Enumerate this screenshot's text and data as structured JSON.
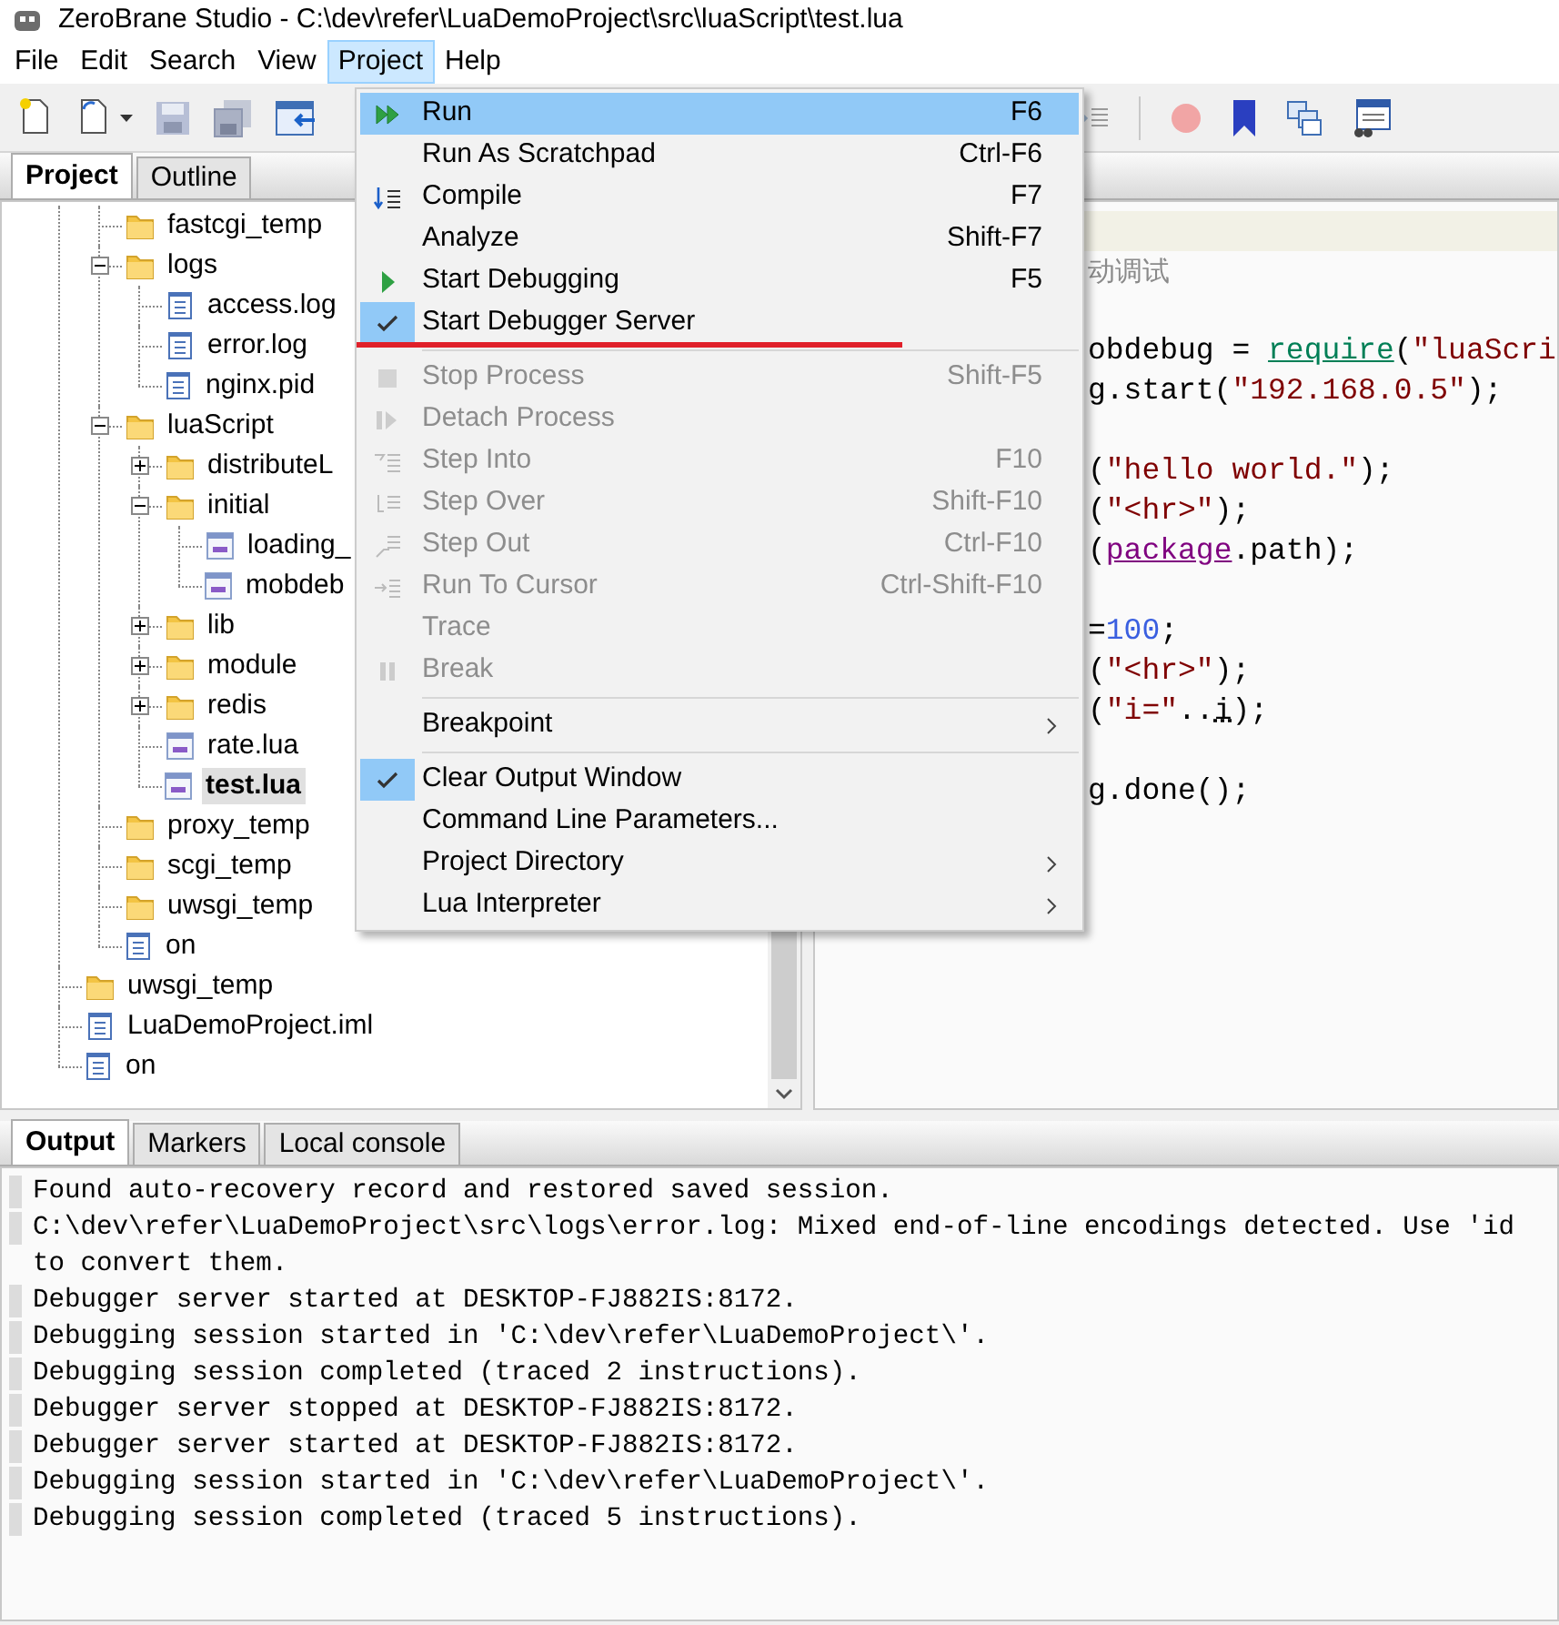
{
  "window": {
    "title": "ZeroBrane Studio - C:\\dev\\refer\\LuaDemoProject\\src\\luaScript\\test.lua"
  },
  "menubar": [
    {
      "label": "File",
      "selected": false
    },
    {
      "label": "Edit",
      "selected": false
    },
    {
      "label": "Search",
      "selected": false
    },
    {
      "label": "View",
      "selected": false
    },
    {
      "label": "Project",
      "selected": true
    },
    {
      "label": "Help",
      "selected": false
    }
  ],
  "project_menu": [
    {
      "kind": "item",
      "label": "Run",
      "shortcut": "F6",
      "selected": true,
      "checked": false,
      "disabled": false,
      "submenu": false,
      "annotated": false
    },
    {
      "kind": "item",
      "label": "Run As Scratchpad",
      "shortcut": "Ctrl-F6",
      "selected": false,
      "checked": false,
      "disabled": false,
      "submenu": false,
      "annotated": false
    },
    {
      "kind": "item",
      "label": "Compile",
      "shortcut": "F7",
      "selected": false,
      "checked": false,
      "disabled": false,
      "submenu": false,
      "annotated": false
    },
    {
      "kind": "item",
      "label": "Analyze",
      "shortcut": "Shift-F7",
      "selected": false,
      "checked": false,
      "disabled": false,
      "submenu": false,
      "annotated": false
    },
    {
      "kind": "item",
      "label": "Start Debugging",
      "shortcut": "F5",
      "selected": false,
      "checked": false,
      "disabled": false,
      "submenu": false,
      "annotated": false
    },
    {
      "kind": "item",
      "label": "Start Debugger Server",
      "selected": false,
      "checked": true,
      "disabled": false,
      "submenu": false,
      "annotated": true
    },
    {
      "kind": "separator"
    },
    {
      "kind": "item",
      "label": "Stop Process",
      "shortcut": "Shift-F5",
      "selected": false,
      "checked": false,
      "disabled": true,
      "submenu": false,
      "annotated": false
    },
    {
      "kind": "item",
      "label": "Detach Process",
      "selected": false,
      "checked": false,
      "disabled": true,
      "submenu": false,
      "annotated": false
    },
    {
      "kind": "item",
      "label": "Step Into",
      "shortcut": "F10",
      "selected": false,
      "checked": false,
      "disabled": true,
      "submenu": false,
      "annotated": false
    },
    {
      "kind": "item",
      "label": "Step Over",
      "shortcut": "Shift-F10",
      "selected": false,
      "checked": false,
      "disabled": true,
      "submenu": false,
      "annotated": false
    },
    {
      "kind": "item",
      "label": "Step Out",
      "shortcut": "Ctrl-F10",
      "selected": false,
      "checked": false,
      "disabled": true,
      "submenu": false,
      "annotated": false
    },
    {
      "kind": "item",
      "label": "Run To Cursor",
      "shortcut": "Ctrl-Shift-F10",
      "selected": false,
      "checked": false,
      "disabled": true,
      "submenu": false,
      "annotated": false
    },
    {
      "kind": "item",
      "label": "Trace",
      "selected": false,
      "checked": false,
      "disabled": true,
      "submenu": false,
      "annotated": false
    },
    {
      "kind": "item",
      "label": "Break",
      "selected": false,
      "checked": false,
      "disabled": true,
      "submenu": false,
      "annotated": false
    },
    {
      "kind": "separator"
    },
    {
      "kind": "item",
      "label": "Breakpoint",
      "selected": false,
      "checked": false,
      "disabled": false,
      "submenu": true,
      "annotated": false
    },
    {
      "kind": "separator"
    },
    {
      "kind": "item",
      "label": "Clear Output Window",
      "selected": false,
      "checked": true,
      "disabled": false,
      "submenu": false,
      "annotated": false
    },
    {
      "kind": "item",
      "label": "Command Line Parameters...",
      "selected": false,
      "checked": false,
      "disabled": false,
      "submenu": false,
      "annotated": false
    },
    {
      "kind": "item",
      "label": "Project Directory",
      "selected": false,
      "checked": false,
      "disabled": false,
      "submenu": true,
      "annotated": false
    },
    {
      "kind": "item",
      "label": "Lua Interpreter",
      "selected": false,
      "checked": false,
      "disabled": false,
      "submenu": true,
      "annotated": false
    }
  ],
  "left_tabs": [
    {
      "label": "Project",
      "selected": true
    },
    {
      "label": "Outline",
      "selected": false
    }
  ],
  "tree": {
    "continued_children": [
      {
        "label": "fastcgi_temp",
        "kind": "folder",
        "selected": false
      },
      {
        "label": "logs",
        "kind": "folder",
        "selected": false,
        "expanded": true,
        "children": [
          {
            "label": "access.log",
            "kind": "file",
            "selected": false
          },
          {
            "label": "error.log",
            "kind": "file",
            "selected": false
          },
          {
            "label": "nginx.pid",
            "kind": "file",
            "selected": false
          }
        ]
      },
      {
        "label": "luaScript",
        "kind": "folder",
        "selected": false,
        "expanded": true,
        "children": [
          {
            "label": "distributeL",
            "kind": "folder",
            "selected": false,
            "expanded": false
          },
          {
            "label": "initial",
            "kind": "folder",
            "selected": false,
            "expanded": true,
            "children": [
              {
                "label": "loading_",
                "kind": "lua",
                "selected": false
              },
              {
                "label": "mobdeb",
                "kind": "lua",
                "selected": false
              }
            ]
          },
          {
            "label": "lib",
            "kind": "folder",
            "selected": false,
            "expanded": false
          },
          {
            "label": "module",
            "kind": "folder",
            "selected": false,
            "expanded": false
          },
          {
            "label": "redis",
            "kind": "folder",
            "selected": false,
            "expanded": false
          },
          {
            "label": "rate.lua",
            "kind": "lua",
            "selected": false
          },
          {
            "label": "test.lua",
            "kind": "lua",
            "selected": true
          }
        ]
      },
      {
        "label": "proxy_temp",
        "kind": "folder",
        "selected": false
      },
      {
        "label": "scgi_temp",
        "kind": "folder",
        "selected": false
      },
      {
        "label": "uwsgi_temp",
        "kind": "folder",
        "selected": false
      },
      {
        "label": "on",
        "kind": "file",
        "selected": false
      }
    ],
    "items": [
      {
        "label": "uwsgi_temp",
        "kind": "folder",
        "selected": false
      },
      {
        "label": "LuaDemoProject.iml",
        "kind": "file",
        "selected": false
      },
      {
        "label": "on",
        "kind": "file",
        "selected": false
      }
    ]
  },
  "editor": {
    "blocks": [
      {
        "lines": [
          {
            "tokens": [
              {
                "kind": "comment",
                "text": "动调试"
              }
            ]
          }
        ]
      },
      {
        "lines": [
          {
            "tokens": [
              {
                "kind": "plain",
                "text": "obdebug = "
              },
              {
                "kind": "function",
                "text": "require"
              },
              {
                "kind": "plain",
                "text": "("
              },
              {
                "kind": "string",
                "text": "\"luaScri"
              }
            ]
          },
          {
            "tokens": [
              {
                "kind": "plain",
                "text": "g.start("
              },
              {
                "kind": "string",
                "text": "\"192.168.0.5\""
              },
              {
                "kind": "plain",
                "text": ");"
              }
            ]
          }
        ]
      },
      {
        "lines": [
          {
            "tokens": [
              {
                "kind": "plain",
                "text": "("
              },
              {
                "kind": "string",
                "text": "\"hello world.\""
              },
              {
                "kind": "plain",
                "text": ");"
              }
            ]
          },
          {
            "tokens": [
              {
                "kind": "plain",
                "text": "("
              },
              {
                "kind": "string",
                "text": "\"<hr>\""
              },
              {
                "kind": "plain",
                "text": ");"
              }
            ]
          },
          {
            "tokens": [
              {
                "kind": "plain",
                "text": "("
              },
              {
                "kind": "library",
                "text": "package"
              },
              {
                "kind": "plain",
                "text": ".path);"
              }
            ]
          }
        ]
      },
      {
        "lines": [
          {
            "tokens": [
              {
                "kind": "plain",
                "text": "="
              },
              {
                "kind": "number",
                "text": "100"
              },
              {
                "kind": "plain",
                "text": ";"
              }
            ]
          },
          {
            "tokens": [
              {
                "kind": "plain",
                "text": "("
              },
              {
                "kind": "string",
                "text": "\"<hr>\""
              },
              {
                "kind": "plain",
                "text": ");"
              }
            ]
          },
          {
            "tokens": [
              {
                "kind": "plain",
                "text": "("
              },
              {
                "kind": "string",
                "text": "\"i=\""
              },
              {
                "kind": "plain",
                "text": ".."
              },
              {
                "kind": "variable",
                "text": "i"
              },
              {
                "kind": "plain",
                "text": ");"
              }
            ]
          }
        ]
      },
      {
        "lines": [
          {
            "tokens": [
              {
                "kind": "plain",
                "text": "g.done();"
              }
            ]
          }
        ]
      }
    ]
  },
  "bottom_tabs": [
    {
      "label": "Output",
      "selected": true
    },
    {
      "label": "Markers",
      "selected": false
    },
    {
      "label": "Local console",
      "selected": false
    }
  ],
  "output": [
    {
      "lines": [
        "Found auto-recovery record and restored saved session."
      ]
    },
    {
      "lines": [
        "C:\\dev\\refer\\LuaDemoProject\\src\\logs\\error.log: Mixed end-of-line encodings detected. Use 'id",
        "to convert them."
      ]
    },
    {
      "lines": [
        "Debugger server started at DESKTOP-FJ882IS:8172."
      ]
    },
    {
      "lines": [
        "Debugging session started in 'C:\\dev\\refer\\LuaDemoProject\\'."
      ]
    },
    {
      "lines": [
        "Debugging session completed (traced 2 instructions)."
      ]
    },
    {
      "lines": [
        "Debugger server stopped at DESKTOP-FJ882IS:8172."
      ]
    },
    {
      "lines": [
        "Debugger server started at DESKTOP-FJ882IS:8172."
      ]
    },
    {
      "lines": [
        "Debugging session started in 'C:\\dev\\refer\\LuaDemoProject\\'."
      ]
    },
    {
      "lines": [
        "Debugging session completed (traced 5 instructions)."
      ]
    }
  ]
}
